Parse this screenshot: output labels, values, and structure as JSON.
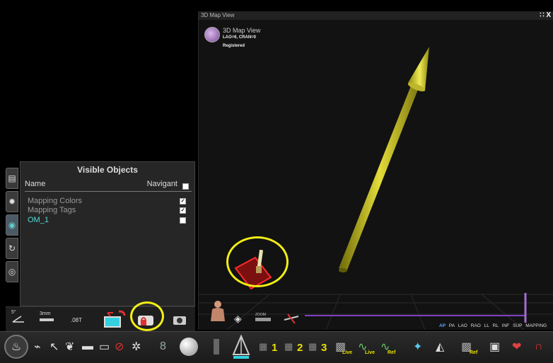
{
  "map_view": {
    "window_title": "3D Map View",
    "window_controls": "∷ X",
    "overlay_title": "3D Map View",
    "angles": "LAO=6, CRAN=0",
    "status": "Registered",
    "views": [
      "AP",
      "PA",
      "LAO",
      "RAO",
      "LL",
      "RL",
      "INF",
      "SUP",
      "MAPPING"
    ],
    "active_view": "AP",
    "zoom_label": "ZOOM"
  },
  "visible_objects": {
    "title": "Visible Objects",
    "col_name": "Name",
    "col_navigant": "Navigant",
    "rows": [
      {
        "name": "Mapping Colors",
        "checked": true
      },
      {
        "name": "Mapping Tags",
        "checked": true
      },
      {
        "name": "OM_1",
        "checked": false
      }
    ]
  },
  "tools": {
    "angle": "5°",
    "distance": "3mm",
    "magnet": ".08T"
  },
  "bottom": {
    "num1": "1",
    "num2": "2",
    "num3": "3",
    "live1": "Live",
    "live2": "Live",
    "ref1": "Ref",
    "ref2": "Ref"
  },
  "colors": {
    "highlight": "#f2ee16",
    "arrow": "#c9c21a",
    "accent": "#55d8d8",
    "active_view": "#5aa7ff"
  }
}
